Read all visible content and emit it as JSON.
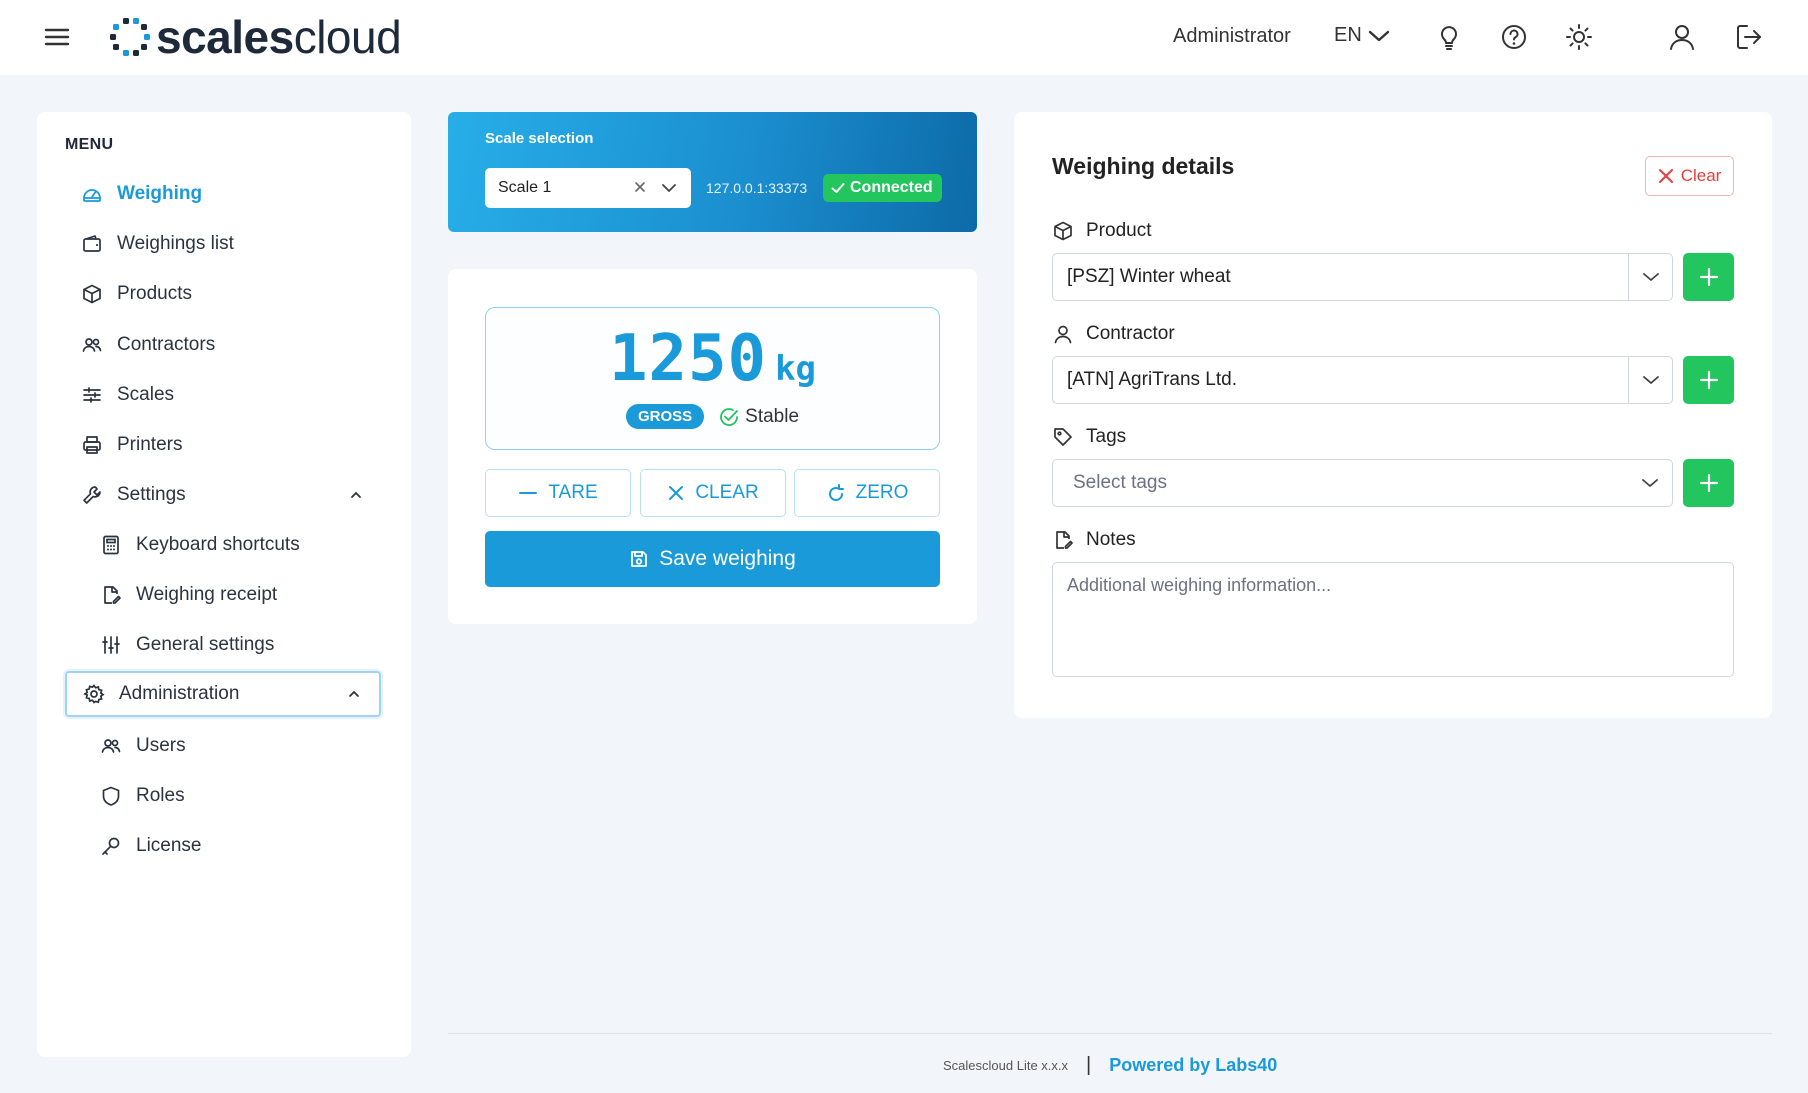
{
  "header": {
    "logo_bold": "scales",
    "logo_light": "cloud",
    "user": "Administrator",
    "language": "EN"
  },
  "sidebar": {
    "title": "MENU",
    "items": [
      {
        "label": "Weighing",
        "icon": "gauge-icon",
        "active": true
      },
      {
        "label": "Weighings list",
        "icon": "wallet-icon"
      },
      {
        "label": "Products",
        "icon": "box-icon"
      },
      {
        "label": "Contractors",
        "icon": "users-icon"
      },
      {
        "label": "Scales",
        "icon": "sliders-icon"
      },
      {
        "label": "Printers",
        "icon": "printer-icon"
      },
      {
        "label": "Settings",
        "icon": "wrench-icon",
        "expanded": true
      },
      {
        "label": "Keyboard shortcuts",
        "icon": "calculator-icon",
        "sub": true
      },
      {
        "label": "Weighing receipt",
        "icon": "file-edit-icon",
        "sub": true
      },
      {
        "label": "General settings",
        "icon": "adjustments-icon",
        "sub": true
      },
      {
        "label": "Administration",
        "icon": "gear-icon",
        "expanded": true
      },
      {
        "label": "Users",
        "icon": "users-icon",
        "sub": true
      },
      {
        "label": "Roles",
        "icon": "shield-icon",
        "sub": true
      },
      {
        "label": "License",
        "icon": "key-icon",
        "sub": true
      }
    ]
  },
  "scale": {
    "label": "Scale selection",
    "selected": "Scale 1",
    "address": "127.0.0.1:33373",
    "status": "Connected"
  },
  "weight": {
    "value": "1250",
    "unit": "kg",
    "mode": "GROSS",
    "stability": "Stable",
    "tare_label": "TARE",
    "clear_label": "CLEAR",
    "zero_label": "ZERO",
    "save_label": "Save weighing"
  },
  "details": {
    "title": "Weighing details",
    "clear_label": "Clear",
    "product_label": "Product",
    "product_value": "[PSZ] Winter wheat",
    "contractor_label": "Contractor",
    "contractor_value": "[ATN] AgriTrans Ltd.",
    "tags_label": "Tags",
    "tags_placeholder": "Select tags",
    "notes_label": "Notes",
    "notes_placeholder": "Additional weighing information..."
  },
  "footer": {
    "version": "Scalescloud Lite x.x.x",
    "separator": "|",
    "powered": "Powered by Labs40"
  },
  "colors": {
    "accent": "#1a9ad9",
    "success": "#22c55e",
    "danger": "#e53e3e",
    "background": "#f2f5f9"
  }
}
